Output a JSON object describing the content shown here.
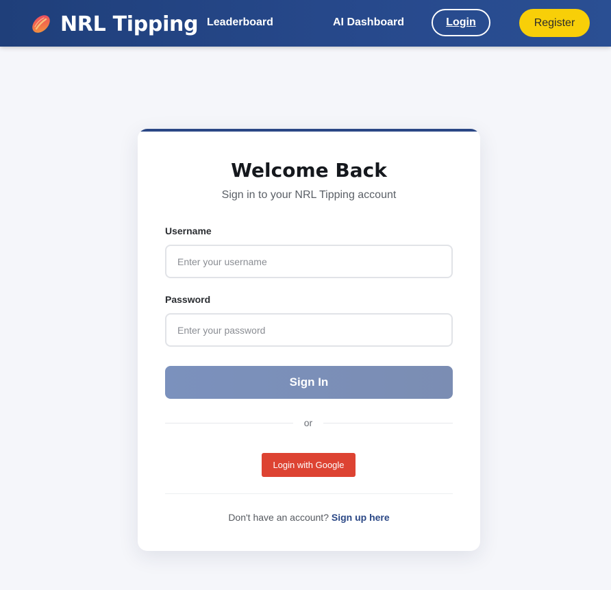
{
  "header": {
    "brand_icon": "rugby-ball-icon",
    "brand_title": "NRL Tipping",
    "nav": {
      "leaderboard": "Leaderboard",
      "ai_dashboard": "AI Dashboard"
    },
    "login_label": "Login",
    "register_label": "Register",
    "colors": {
      "background": "#27498c",
      "register_button": "#f8cf08"
    }
  },
  "login_card": {
    "title": "Welcome Back",
    "subtitle": "Sign in to your NRL Tipping account",
    "username": {
      "label": "Username",
      "placeholder": "Enter your username",
      "value": ""
    },
    "password": {
      "label": "Password",
      "placeholder": "Enter your password",
      "value": ""
    },
    "sign_in_label": "Sign In",
    "divider_text": "or",
    "google_label": "Login with Google",
    "footer_prompt": "Don't have an account?",
    "signup_link": "Sign up here",
    "colors": {
      "accent": "#2a4785",
      "sign_in_button": "#7b8fb8",
      "google_button": "#dd4332"
    }
  }
}
